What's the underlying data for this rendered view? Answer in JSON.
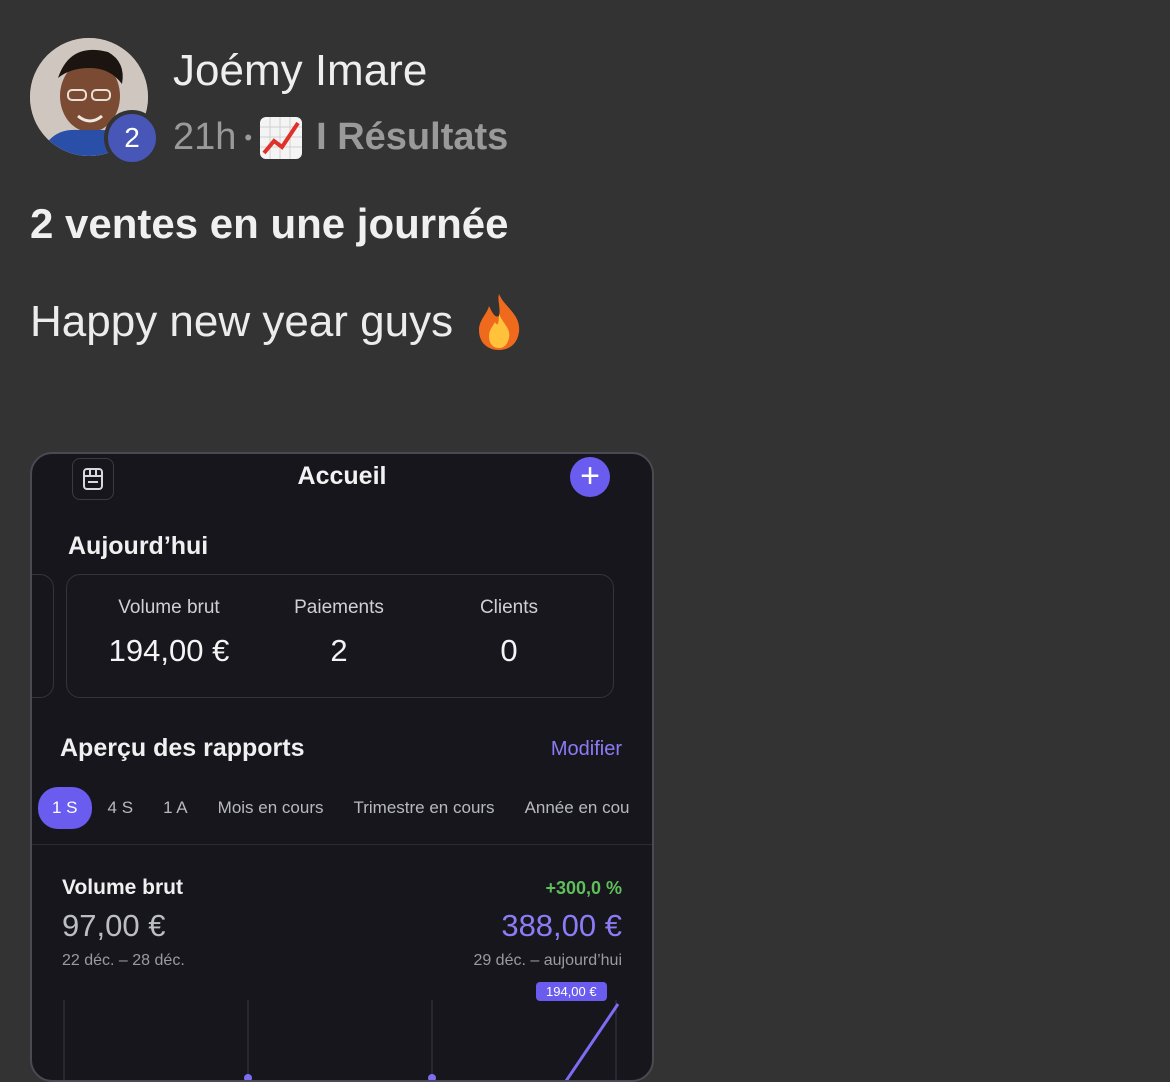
{
  "post": {
    "author": "Joémy Imare",
    "level_badge": "2",
    "time_ago": "21h",
    "separator": "•",
    "category_icon": "chart-increasing-emoji",
    "category": "I Résultats",
    "title": "2 ventes en une journée",
    "body": "Happy new year guys",
    "body_icon": "fire-emoji"
  },
  "screenshot": {
    "nav_title": "Accueil",
    "today_heading": "Aujourd’hui",
    "stats": [
      {
        "label": "Volume brut",
        "value": "194,00 €"
      },
      {
        "label": "Paiements",
        "value": "2"
      },
      {
        "label": "Clients",
        "value": "0"
      }
    ],
    "reports_heading": "Aperçu des rapports",
    "edit_label": "Modifier",
    "periods": [
      "1 S",
      "4 S",
      "1 A",
      "Mois en cours",
      "Trimestre en cours",
      "Année en cou"
    ],
    "active_period": "1 S",
    "volume_title": "Volume brut",
    "delta": "+300,0 %",
    "previous_value": "97,00 €",
    "current_value": "388,00 €",
    "previous_range": "22 déc. – 28 déc.",
    "current_range": "29 déc. – aujourd’hui",
    "tooltip": "194,00 €",
    "colors": {
      "accent": "#6b5cf0",
      "positive": "#5fbf5a",
      "background": "#16161c"
    }
  }
}
